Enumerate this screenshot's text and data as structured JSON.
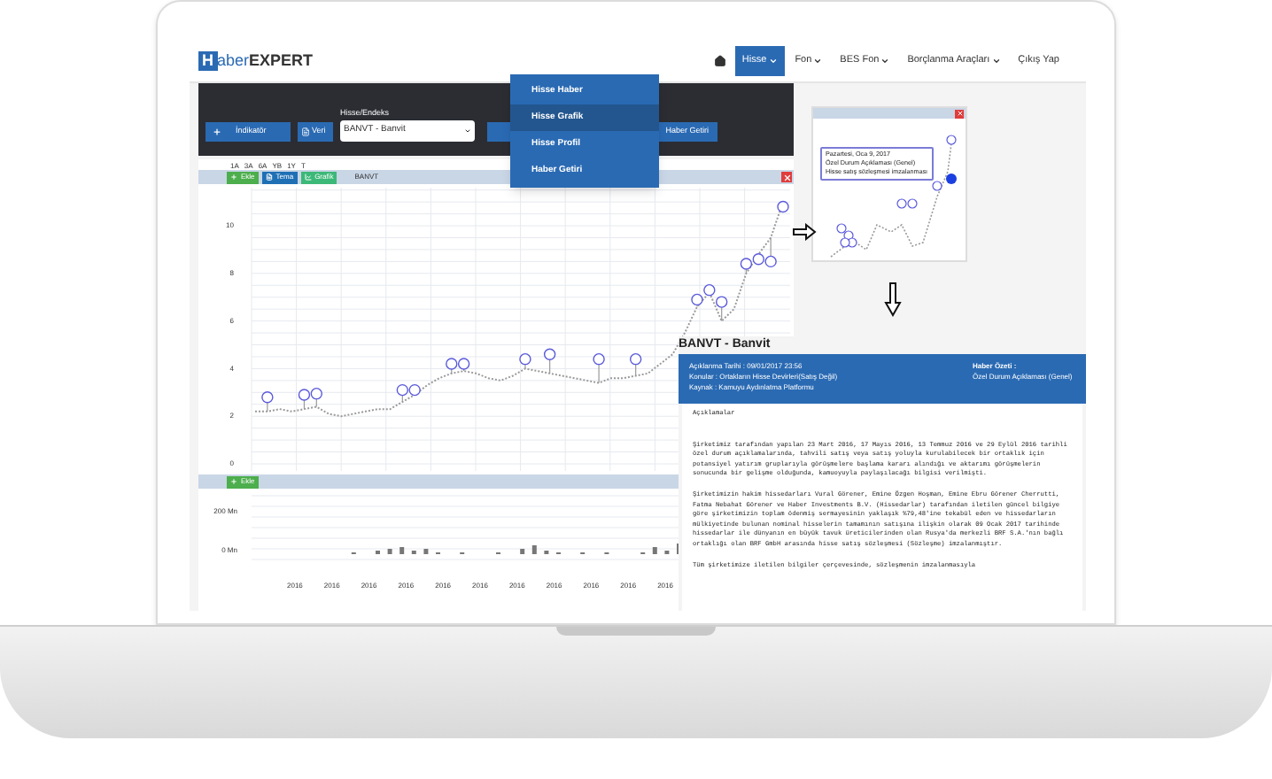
{
  "brand": {
    "letter": "H",
    "name": "aber",
    "suffix": "EXPERT"
  },
  "nav": {
    "items": [
      {
        "label": "Hisse",
        "selected": true,
        "has_caret": true
      },
      {
        "label": "Fon",
        "selected": false,
        "has_caret": true
      },
      {
        "label": "BES Fon",
        "selected": false,
        "has_caret": true
      },
      {
        "label": "Borçlanma Araçları",
        "selected": false,
        "has_caret": true
      },
      {
        "label": "Çıkış Yap",
        "selected": false,
        "has_caret": false
      }
    ]
  },
  "dropdown": {
    "items": [
      {
        "label": "Hisse Haber",
        "selected": false
      },
      {
        "label": "Hisse Grafik",
        "selected": true
      },
      {
        "label": "Hisse Profil",
        "selected": false
      },
      {
        "label": "Haber Getiri",
        "selected": false
      }
    ]
  },
  "toolbar": {
    "indicator_button": "İndikatör",
    "data_button": "Veri",
    "field_label": "Hisse/Endeks",
    "select_value": "BANVT - Banvit",
    "news_button": "Haber Getiri"
  },
  "chart": {
    "ranges": [
      "1A",
      "3A",
      "6A",
      "YB",
      "1Y",
      "T"
    ],
    "buttons": [
      {
        "label": "Ekle",
        "kind": "add"
      },
      {
        "label": "Tema",
        "kind": "theme"
      },
      {
        "label": "Grafik",
        "kind": "chart"
      }
    ],
    "chart_data": {
      "type": "line",
      "ylim": [
        0,
        11.6
      ],
      "yticks": [
        0,
        2,
        4,
        6,
        8,
        10
      ],
      "grid": true,
      "series": [
        {
          "name": "BANVT",
          "color": "#9a9a9a",
          "line_style": "dotted",
          "values": [
            2.2,
            2.2,
            2.3,
            2.2,
            2.3,
            2.4,
            2.1,
            2.0,
            2.1,
            2.2,
            2.3,
            2.3,
            2.6,
            2.9,
            3.3,
            3.6,
            3.8,
            3.9,
            3.8,
            3.6,
            3.5,
            3.7,
            4.0,
            3.9,
            3.8,
            3.7,
            3.6,
            3.5,
            3.4,
            3.6,
            3.6,
            3.7,
            3.8,
            4.2,
            4.6,
            5.5,
            6.6,
            7.2,
            6.0,
            6.5,
            8.0,
            8.8,
            9.5,
            11.0
          ]
        }
      ]
    },
    "volume_button": "Ekle",
    "volume_labels": [
      "200 Mn",
      "0 Mn"
    ],
    "x_labels": [
      "2016",
      "2016",
      "2016",
      "2016",
      "2016",
      "2016",
      "2016",
      "2016",
      "2016",
      "2016",
      "2016"
    ]
  },
  "inset": {
    "tooltip": [
      "Pazartesi, Oca 9, 2017",
      "Özel Durum Açıklaması (Genel)",
      "Hisse satış sözleşmesi imzalanması"
    ]
  },
  "news": {
    "title": "BANVT - Banvit",
    "meta": [
      "Açıklanma Tarihi : 09/01/2017 23:56",
      "Konular : Ortakların Hisse Devirleri(Satış Değil)",
      "Kaynak : Kamuyu Aydınlatma Platformu"
    ],
    "summary_label": "Haber Özeti :",
    "summary": "Özel Durum Açıklaması (Genel)",
    "heading": "Açıklamalar",
    "paragraphs": [
      "Şirketimiz tarafından yapılan 23 Mart 2016, 17 Mayıs 2016, 13 Temmuz 2016 ve 29 Eylül 2016 tarihli özel durum açıklamalarında, tahvili satış veya satış yoluyla kurulabilecek bir ortaklık için potansiyel yatırım gruplarıyla görüşmelere başlama kararı alındığı ve aktarımı görüşmelerin sonucunda bir gelişme olduğunda, kamuoyuyla paylaşılacağı bilgisi verilmişti.",
      "Şirketimizin hakim hissedarları Vural Görener, Emine Özgen Hoşman, Emine Ebru Görener Cherrutti, Fatma Nebahat Görener ve Haber Investments B.V. (Hissedarlar) tarafından iletilen güncel bilgiye göre şirketimizin toplam ödenmiş sermayesinin yaklaşık %79,48'ine tekabül eden ve hissedarların mülkiyetinde bulunan nominal hisselerin tamamının satışına ilişkin olarak 09 Ocak 2017 tarihinde hissedarlar ile dünyanın en büyük tavuk üreticilerinden olan Rusya'da merkezli BRF S.A.'nın bağlı ortaklığı olan BRF GmbH arasında hisse satış sözleşmesi (Sözleşme) imzalanmıştır.",
      "Tüm şirketimize iletilen bilgiler çerçevesinde, sözleşmenin imzalanmasıyla"
    ]
  }
}
